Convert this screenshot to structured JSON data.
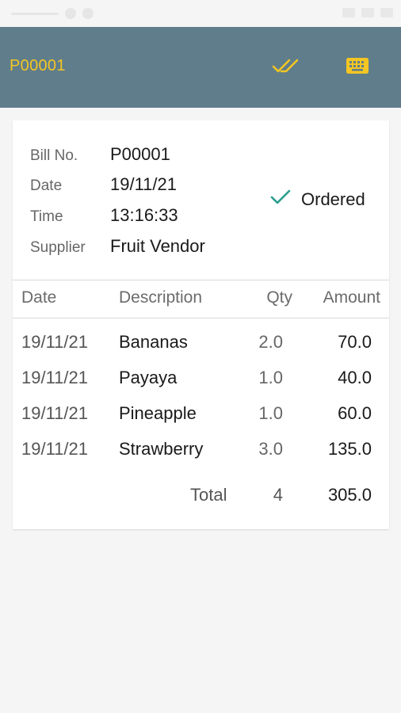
{
  "app_bar": {
    "title": "P00001",
    "actions": [
      {
        "icon": "double-check-icon",
        "label": "Mark received"
      },
      {
        "icon": "keyboard-icon",
        "label": "Keyboard"
      }
    ],
    "background": "#607d8b",
    "accent": "#f3c623"
  },
  "bill": {
    "fields": [
      {
        "label": "Bill No.",
        "value": "P00001"
      },
      {
        "label": "Date",
        "value": "19/11/21"
      },
      {
        "label": "Time",
        "value": "13:16:33"
      },
      {
        "label": "Supplier",
        "value": "Fruit Vendor"
      }
    ],
    "status": {
      "icon": "check-icon",
      "label": "Ordered",
      "color": "#2a9d8f"
    }
  },
  "table": {
    "headers": {
      "date": "Date",
      "description": "Description",
      "qty": "Qty",
      "amount": "Amount"
    },
    "rows": [
      {
        "date": "19/11/21",
        "description": "Bananas",
        "qty": "2.0",
        "amount": "70.0"
      },
      {
        "date": "19/11/21",
        "description": "Payaya",
        "qty": "1.0",
        "amount": "40.0"
      },
      {
        "date": "19/11/21",
        "description": "Pineapple",
        "qty": "1.0",
        "amount": "60.0"
      },
      {
        "date": "19/11/21",
        "description": "Strawberry",
        "qty": "3.0",
        "amount": "135.0"
      }
    ],
    "total": {
      "label": "Total",
      "qty": "4",
      "amount": "305.0"
    }
  }
}
